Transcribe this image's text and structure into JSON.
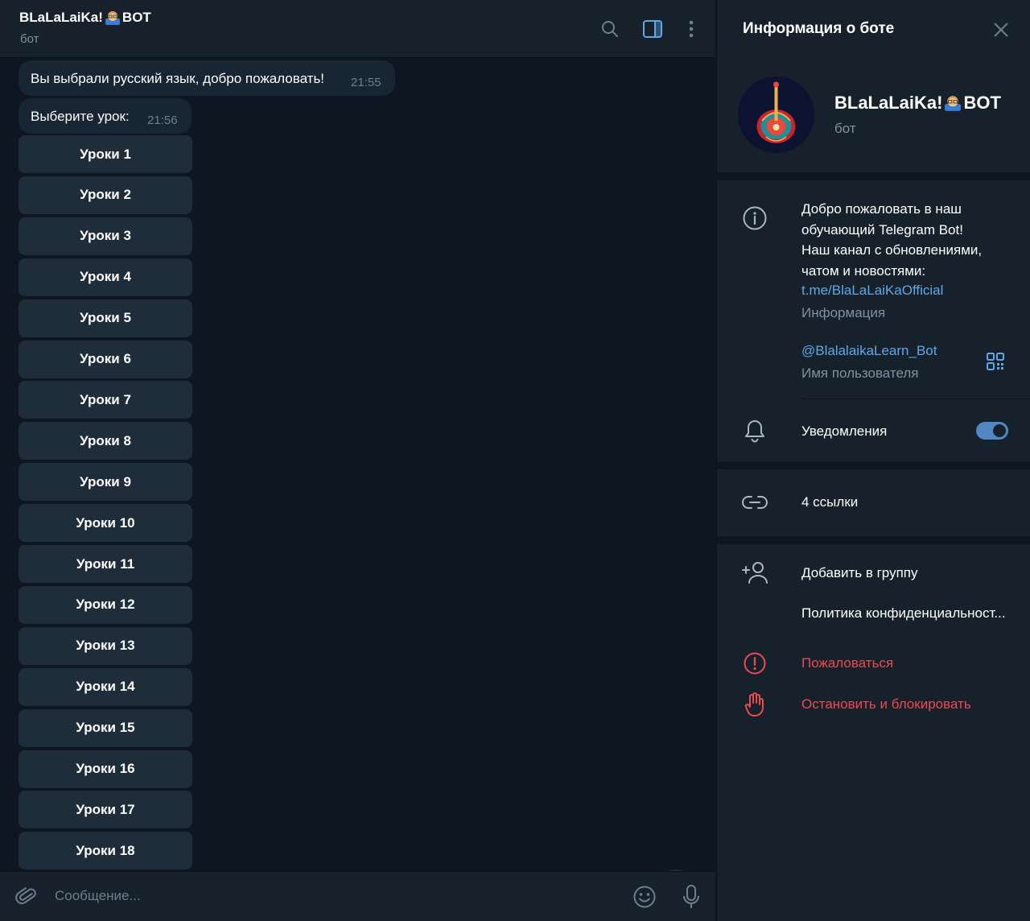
{
  "chat": {
    "title_part1": "BLaLaLaiKa!",
    "title_part2": "BOT",
    "subtitle": "бот",
    "messages": [
      {
        "text": "Вы выбрали русский язык, добро пожаловать!",
        "time": "21:55"
      },
      {
        "text": "Выберите урок:",
        "time": "21:56"
      }
    ],
    "keyboard": [
      "Уроки 1",
      "Уроки 2",
      "Уроки 3",
      "Уроки 4",
      "Уроки 5",
      "Уроки 6",
      "Уроки 7",
      "Уроки 8",
      "Уроки 9",
      "Уроки 10",
      "Уроки 11",
      "Уроки 12",
      "Уроки 13",
      "Уроки 14",
      "Уроки 15",
      "Уроки 16",
      "Уроки 17",
      "Уроки 18"
    ],
    "composer_placeholder": "Сообщение..."
  },
  "icons": {
    "header": [
      "search-icon",
      "sidebar-toggle-icon",
      "more-vertical-icon"
    ],
    "composer": [
      "attach-icon",
      "emoji-icon",
      "microphone-icon"
    ],
    "scroll": "chevron-down-icon"
  },
  "panel": {
    "title": "Информация о боте",
    "name_part1": "BLaLaLaiKa!",
    "name_part2": "BOT",
    "subtitle": "бот",
    "description_lines": [
      "Добро пожаловать в наш",
      "обучающий Telegram Bot!",
      "Наш канал с обновлениями,",
      "чатом и новостями:"
    ],
    "description_link": "t.me/BlaLaLaiKaOfficial",
    "description_label": "Информация",
    "username": "@BlalalaikaLearn_Bot",
    "username_label": "Имя пользователя",
    "notifications_label": "Уведомления",
    "notifications_on": true,
    "links_label": "4 ссылки",
    "add_to_group": "Добавить в группу",
    "privacy": "Политика конфиденциальност...",
    "report": "Пожаловаться",
    "block": "Остановить и блокировать"
  },
  "colors": {
    "chat_bg": "#0e1621",
    "panel_bg": "#17212b",
    "bubble": "#182533",
    "button": "#1f2c3a",
    "accent": "#5288c1",
    "link": "#5ea8e9",
    "danger": "#ec4a52"
  }
}
